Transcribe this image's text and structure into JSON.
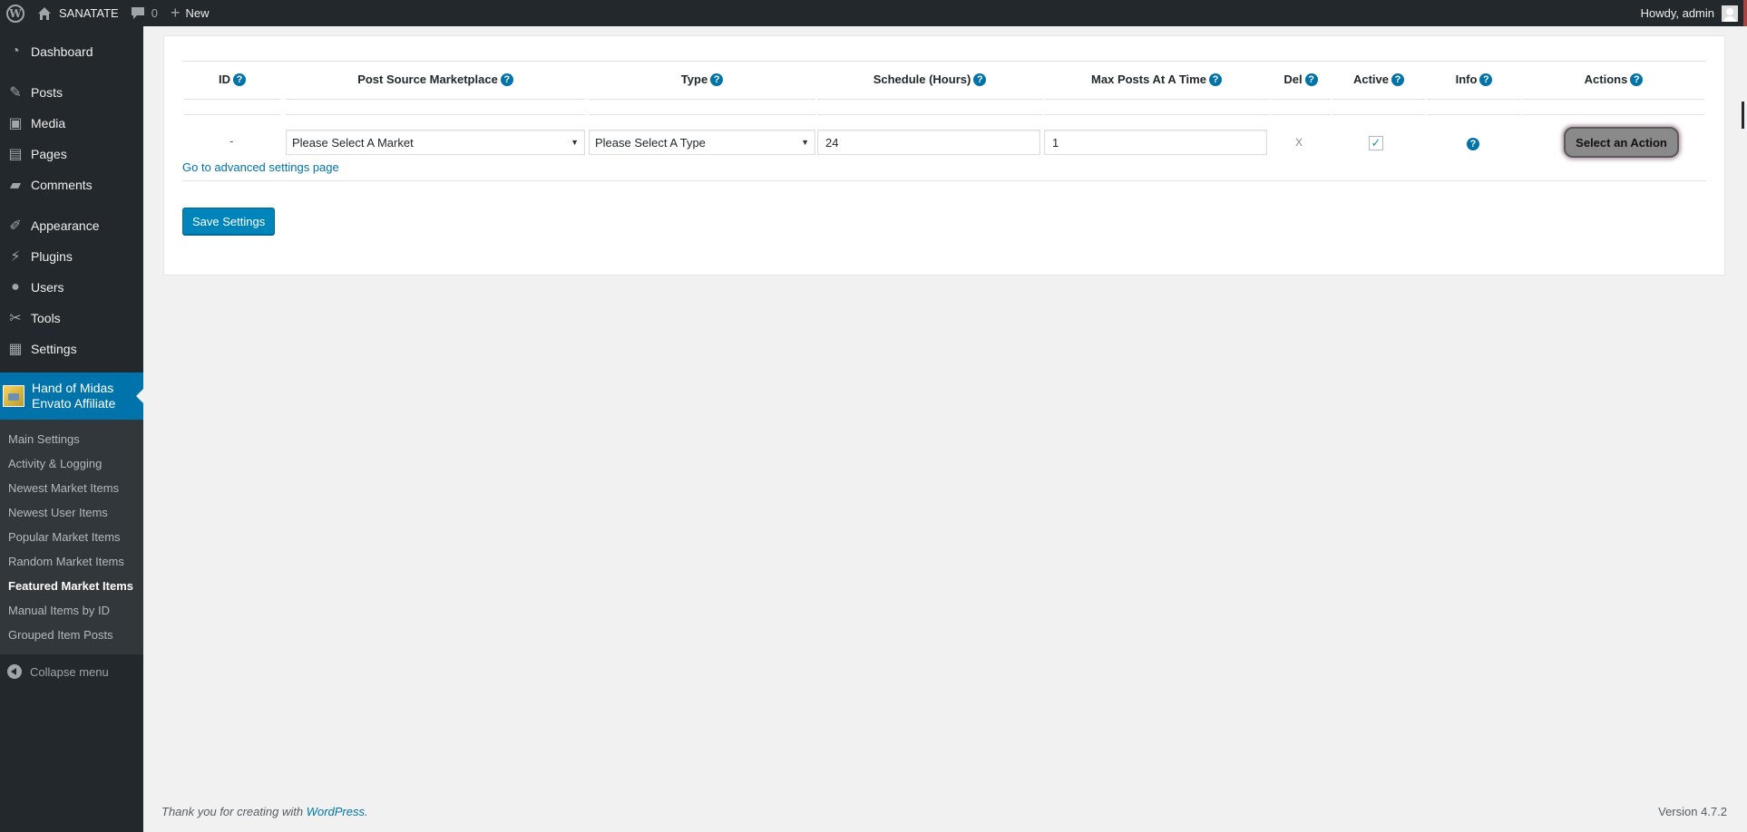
{
  "adminbar": {
    "site_name": "SANATATE",
    "comments_count": "0",
    "new_label": "New",
    "howdy": "Howdy, admin"
  },
  "sidebar": {
    "items": [
      {
        "label": "Dashboard",
        "icon": "dashboard-icon"
      },
      {
        "label": "Posts",
        "icon": "pin-icon"
      },
      {
        "label": "Media",
        "icon": "media-icon"
      },
      {
        "label": "Pages",
        "icon": "pages-icon"
      },
      {
        "label": "Comments",
        "icon": "comment-icon"
      },
      {
        "label": "Appearance",
        "icon": "brush-icon"
      },
      {
        "label": "Plugins",
        "icon": "plug-icon"
      },
      {
        "label": "Users",
        "icon": "user-icon"
      },
      {
        "label": "Tools",
        "icon": "wrench-icon"
      },
      {
        "label": "Settings",
        "icon": "settings-icon"
      }
    ],
    "current_plugin": {
      "line1": "Hand of Midas",
      "line2": "Envato Affiliate"
    },
    "submenu": [
      "Main Settings",
      "Activity & Logging",
      "Newest Market Items",
      "Newest User Items",
      "Popular Market Items",
      "Random Market Items",
      "Featured Market Items",
      "Manual Items by ID",
      "Grouped Item Posts"
    ],
    "active_submenu": "Featured Market Items",
    "collapse_label": "Collapse menu"
  },
  "table": {
    "headers": [
      "ID",
      "Post Source Marketplace",
      "Type",
      "Schedule (Hours)",
      "Max Posts At A Time",
      "Del",
      "Active",
      "Info",
      "Actions"
    ],
    "row": {
      "id": "-",
      "market": "Please Select A Market",
      "type": "Please Select A Type",
      "schedule": "24",
      "max_posts": "1",
      "del": "X",
      "active_checked": true,
      "action": "Select an Action"
    },
    "advanced_link": "Go to advanced settings page"
  },
  "save_label": "Save Settings",
  "footer": {
    "thanks_prefix": "Thank you for creating with ",
    "wordpress": "WordPress",
    "thanks_suffix": ".",
    "version": "Version 4.7.2"
  },
  "colors": {
    "accent": "#0073aa",
    "sidebar": "#23282d",
    "button": "#0085ba"
  }
}
